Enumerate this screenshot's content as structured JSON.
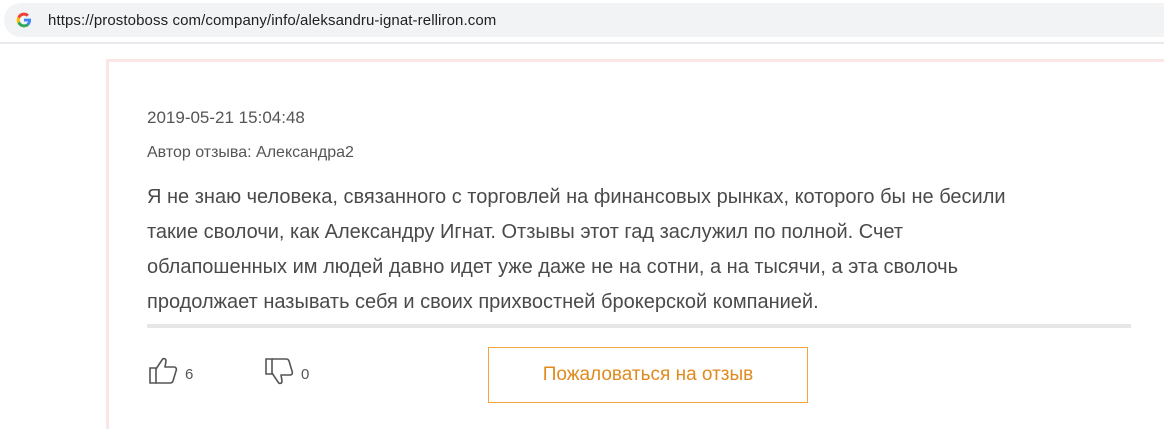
{
  "browser": {
    "url": "https://prostoboss com/company/info/aleksandru-ignat-relliron.com",
    "search_engine_icon": "google-g-icon"
  },
  "review": {
    "date": "2019-05-21 15:04:48",
    "author": "Автор отзыва: Александра2",
    "text_lines": [
      "Я не знаю человека, связанного с торговлей на финансовых рынках, которого бы не бесили",
      "такие сволочи, как Александру Игнат. Отзывы этот гад заслужил по полной. Счет",
      "облапошенных им людей давно идет уже даже не на сотни, а на тысячи, а эта сволочь",
      "продолжает называть себя и своих прихвостней брокерской компанией."
    ],
    "likes": "6",
    "dislikes": "0",
    "complain_label": "Пожаловаться на отзыв"
  },
  "colors": {
    "card_border": "#fbe5e5",
    "accent_orange": "#e08a1e",
    "text_gray": "#4a4a4a"
  }
}
